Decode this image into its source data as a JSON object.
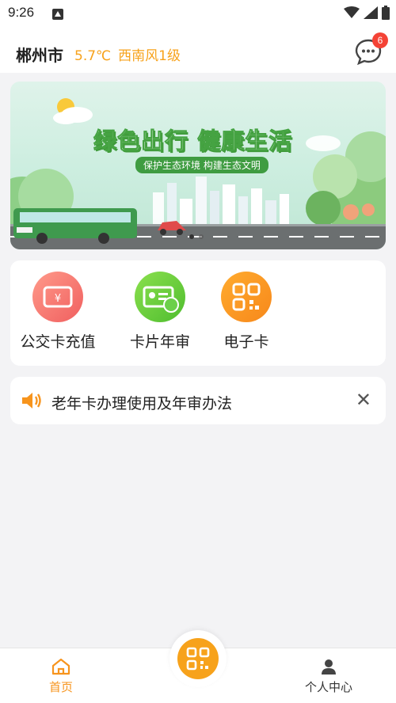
{
  "status_bar": {
    "time": "9:26",
    "icons": [
      "app-notification-icon",
      "wifi-icon",
      "signal-icon",
      "battery-icon"
    ]
  },
  "header": {
    "city": "郴州市",
    "temperature": "5.7℃",
    "wind": "西南风1级",
    "message_icon": "chat-bubble-icon",
    "message_badge": "6"
  },
  "banner": {
    "title": "绿色出行 健康生活",
    "subtitle": "保护生态环境 构建生态文明",
    "slide_count": 2,
    "active_slide": 1
  },
  "services": [
    {
      "label": "公交卡充值",
      "icon": "card-recharge-icon",
      "color": "#f36f6f"
    },
    {
      "label": "卡片年审",
      "icon": "card-review-icon",
      "color": "#6fce3a"
    },
    {
      "label": "电子卡",
      "icon": "qr-code-icon",
      "color": "#f7941d"
    }
  ],
  "notice": {
    "icon": "speaker-icon",
    "text": "老年卡办理使用及年审办法",
    "close_icon": "close-icon"
  },
  "bottom_nav": {
    "home_label": "首页",
    "center_icon": "qr-code-icon",
    "profile_label": "个人中心",
    "active_color": "#f7941d"
  }
}
